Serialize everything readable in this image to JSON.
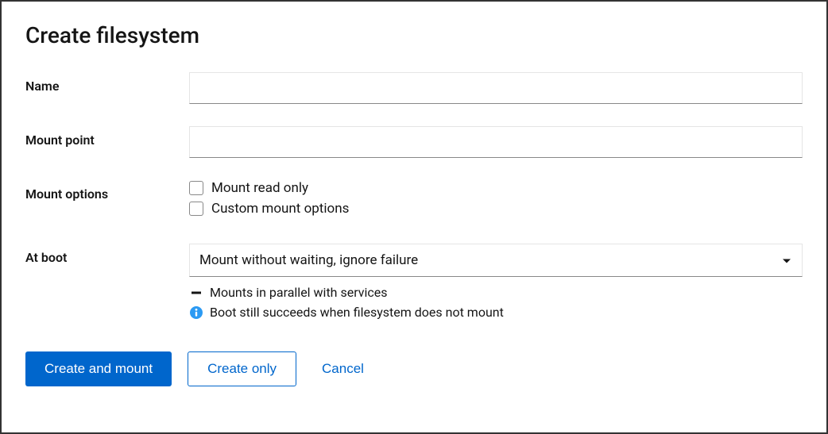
{
  "dialog": {
    "title": "Create filesystem"
  },
  "form": {
    "name": {
      "label": "Name",
      "value": ""
    },
    "mount_point": {
      "label": "Mount point",
      "value": ""
    },
    "mount_options": {
      "label": "Mount options",
      "read_only_label": "Mount read only",
      "custom_label": "Custom mount options"
    },
    "at_boot": {
      "label": "At boot",
      "selected": "Mount without waiting, ignore failure",
      "hint1": "Mounts in parallel with services",
      "hint2": "Boot still succeeds when filesystem does not mount"
    }
  },
  "actions": {
    "primary": "Create and mount",
    "secondary": "Create only",
    "cancel": "Cancel"
  },
  "colors": {
    "primary": "#0066cc",
    "info": "#2b9af3"
  }
}
